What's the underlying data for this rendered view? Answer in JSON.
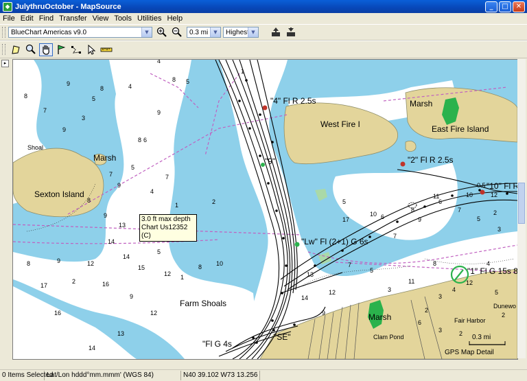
{
  "window": {
    "title": "JulythruOctober - MapSource",
    "minimize": "_",
    "maximize": "□",
    "close": "✕"
  },
  "menu": [
    "File",
    "Edit",
    "Find",
    "Transfer",
    "View",
    "Tools",
    "Utilities",
    "Help"
  ],
  "toolbar": {
    "product_select": "BlueChart Americas v9.0",
    "zoom_select": "0.3 mi",
    "detail_select": "Highest"
  },
  "tools": {
    "icons": [
      "zoom-area-icon",
      "zoom-tool-icon",
      "hand-tool-icon",
      "waypoint-flag-icon",
      "route-tool-icon",
      "select-arrow-icon",
      "measure-ruler-icon"
    ]
  },
  "map": {
    "tooltip_line1": "3.0 ft max depth",
    "tooltip_line2": "Chart Us12352 (C)",
    "scale": "0.3 mi",
    "detail": "GPS Map Detail",
    "handle": "▸",
    "places": {
      "sexton": "Sexton Island",
      "marsh_west": "Marsh",
      "shoal": "Shoal",
      "west_fire": "West Fire I",
      "marsh_north": "Marsh",
      "east_fire": "East Fire Island",
      "farm_shoals": "Farm Shoals",
      "marsh_south": "Marsh",
      "clam_pond": "Clam Pond",
      "fair_harbor": "Fair Harbor",
      "dunewood": "Dunewo"
    },
    "lights": {
      "l4": "\"4\" Fl R 2.5s",
      "l2": "\"2\" Fl R 2.5s",
      "l10": "\"10\" Fl R",
      "lew": "\"Lw\" Fl (2+1) G 6s",
      "l1": "\"1\" Fl G 15s 8",
      "l9": "\"9\"",
      "lse": "\"SE\"",
      "lg4": "\"Fl G 4s"
    },
    "soundings": [
      "4",
      "8",
      "9",
      "5",
      "4",
      "9",
      "5",
      "6",
      "7",
      "9",
      "8",
      "8",
      "7",
      "3",
      "8",
      "9",
      "4",
      "1",
      "2",
      "1",
      "5",
      "6",
      "7",
      "8",
      "9",
      "13",
      "2",
      "5",
      "12",
      "1",
      "8",
      "10",
      "14",
      "14",
      "15",
      "12",
      "16",
      "9",
      "12",
      "13",
      "14",
      "16",
      "17",
      "8",
      "9",
      "2",
      "5",
      "10",
      "7",
      "6",
      "8",
      "11",
      "9",
      "13",
      "12",
      "7",
      "5",
      "3",
      "11",
      "17",
      "14",
      "9",
      "2",
      "3",
      "4",
      "12",
      "8",
      "6",
      "7",
      "5",
      "10",
      "0.5",
      "12",
      "2",
      "3",
      "4",
      "5",
      "2",
      "6",
      "3",
      "2"
    ]
  },
  "status": {
    "selected": "0 Items Selected",
    "format": "Lat/Lon hddd°mm.mmm' (WGS 84)",
    "position": "N40 39.102 W73 13.256"
  },
  "colors": {
    "water_shallow": "#8ed0ea",
    "water_deep": "#ffffff",
    "land": "#e3d59b",
    "green": "#2bb24c"
  }
}
